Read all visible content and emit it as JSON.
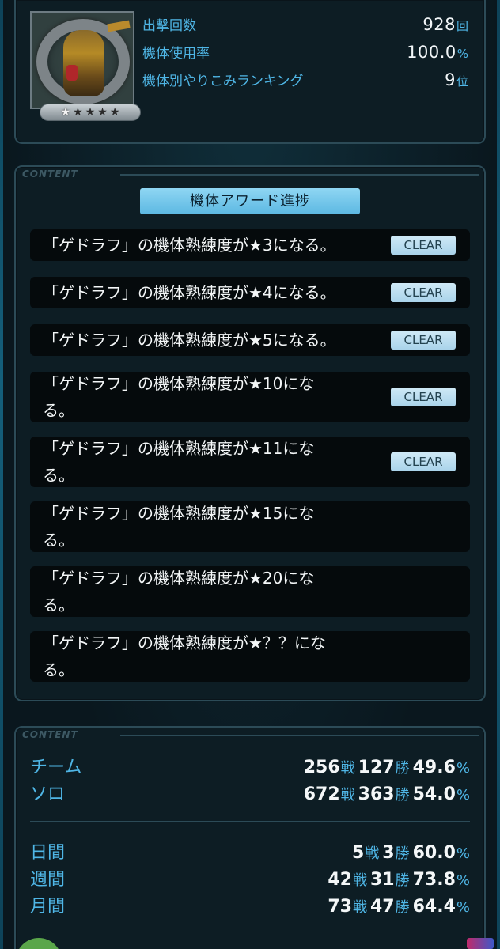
{
  "stats": {
    "sorties_label": "出撃回数",
    "sorties_value": "928",
    "sorties_unit": "回",
    "usage_label": "機体使用率",
    "usage_value": "100.0",
    "usage_unit": "%",
    "ranking_label": "機体別やりこみランキング",
    "ranking_value": "9",
    "ranking_unit": "位",
    "star_rank": 5
  },
  "award": {
    "content_tag": "CONTENT",
    "title": "機体アワード進捗",
    "clear_label": "CLEAR",
    "items": [
      {
        "line1": "「ゲドラフ」の機体熟練度が★3になる。",
        "line2": "",
        "cleared": true
      },
      {
        "line1": "「ゲドラフ」の機体熟練度が★4になる。",
        "line2": "",
        "cleared": true
      },
      {
        "line1": "「ゲドラフ」の機体熟練度が★5になる。",
        "line2": "",
        "cleared": true
      },
      {
        "line1": "「ゲドラフ」の機体熟練度が★10にな",
        "line2": "る。",
        "cleared": true
      },
      {
        "line1": "「ゲドラフ」の機体熟練度が★11にな",
        "line2": "る。",
        "cleared": true
      },
      {
        "line1": "「ゲドラフ」の機体熟練度が★15にな",
        "line2": "る。",
        "cleared": false
      },
      {
        "line1": "「ゲドラフ」の機体熟練度が★20にな",
        "line2": "る。",
        "cleared": false
      },
      {
        "line1": "「ゲドラフ」の機体熟練度が★？？にな",
        "line2": "る。",
        "cleared": false
      }
    ]
  },
  "results": {
    "content_tag": "CONTENT",
    "battle_unit": "戦",
    "win_unit": "勝",
    "pct_unit": "%",
    "rows": [
      {
        "label": "チーム",
        "battles": "256",
        "wins": "127",
        "rate": "49.6"
      },
      {
        "label": "ソロ",
        "battles": "672",
        "wins": "363",
        "rate": "54.0"
      },
      {
        "label": "日間",
        "battles": "5",
        "wins": "3",
        "rate": "60.0"
      },
      {
        "label": "週間",
        "battles": "42",
        "wins": "31",
        "rate": "73.8"
      },
      {
        "label": "月間",
        "battles": "73",
        "wins": "47",
        "rate": "64.4"
      }
    ]
  }
}
